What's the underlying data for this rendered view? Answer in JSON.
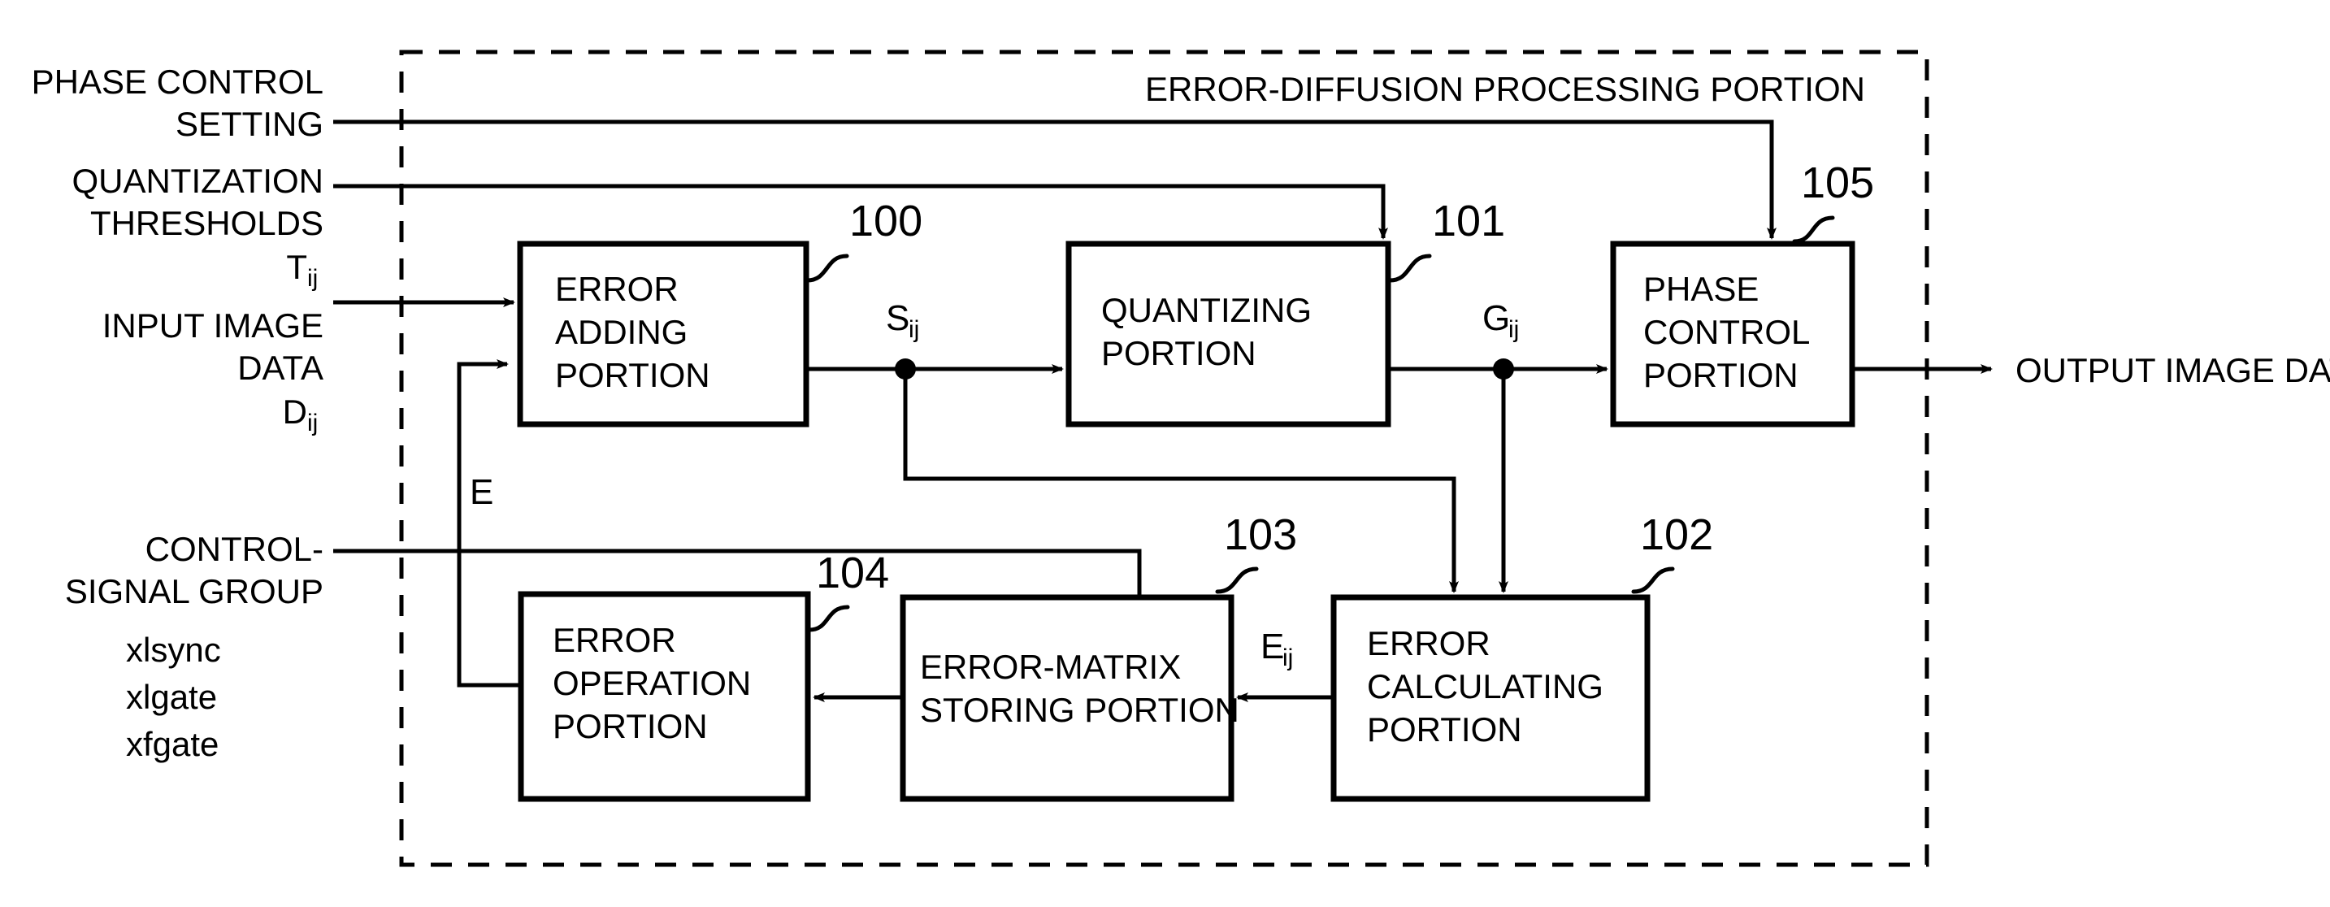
{
  "figure": {
    "title": "ERROR-DIFFUSION PROCESSING PORTION",
    "inputs": [
      {
        "line1": "PHASE CONTROL",
        "line2": "SETTING",
        "line3": "",
        "sub": ""
      },
      {
        "line1": "QUANTIZATION",
        "line2": "THRESHOLDS",
        "line3": "T",
        "sub": "ij"
      },
      {
        "line1": "INPUT IMAGE",
        "line2": "DATA",
        "line3": "D",
        "sub": "ij"
      }
    ],
    "control_group": {
      "line1": "CONTROL-",
      "line2": "SIGNAL GROUP",
      "signals": [
        "xlsync",
        "xlgate",
        "xfgate"
      ]
    },
    "output": "OUTPUT IMAGE DATA",
    "blocks": [
      {
        "id": "100",
        "lines": [
          "ERROR",
          "ADDING",
          "PORTION"
        ]
      },
      {
        "id": "101",
        "lines": [
          "QUANTIZING",
          "PORTION"
        ]
      },
      {
        "id": "105",
        "lines": [
          "PHASE",
          "CONTROL",
          "PORTION"
        ]
      },
      {
        "id": "102",
        "lines": [
          "ERROR",
          "CALCULATING",
          "PORTION"
        ]
      },
      {
        "id": "103",
        "lines": [
          "ERROR-MATRIX",
          "STORING PORTION"
        ]
      },
      {
        "id": "104",
        "lines": [
          "ERROR",
          "OPERATION",
          "PORTION"
        ]
      }
    ],
    "signals": [
      {
        "name": "S",
        "sub": "ij"
      },
      {
        "name": "G",
        "sub": "ij"
      },
      {
        "name": "E",
        "sub": "ij"
      },
      {
        "name": "E",
        "sub": ""
      }
    ],
    "colors": {
      "ink": "#000000",
      "paper": "#ffffff"
    }
  }
}
